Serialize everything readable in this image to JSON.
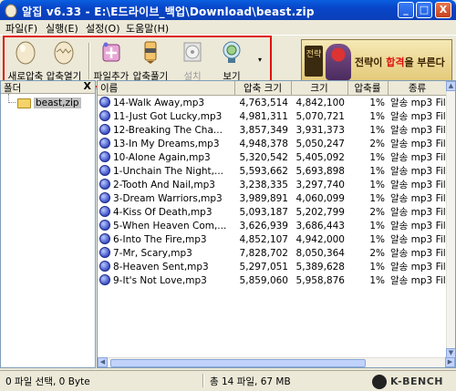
{
  "window": {
    "title": "알집  v6.33 - E:\\E드라이브_백업\\Download\\beast.zip",
    "min_label": "_",
    "max_label": "□",
    "close_label": "X"
  },
  "menu": [
    {
      "label": "파일(F)"
    },
    {
      "label": "실행(E)"
    },
    {
      "label": "설정(O)"
    },
    {
      "label": "도움말(H)"
    }
  ],
  "toolbar": {
    "buttons": [
      {
        "label": "새로압축",
        "icon": "new-archive-egg-icon",
        "enabled": true
      },
      {
        "label": "압축열기",
        "icon": "open-archive-egg-icon",
        "enabled": true
      },
      {
        "label": "파일추가",
        "icon": "add-file-icon",
        "enabled": true
      },
      {
        "label": "압축풀기",
        "icon": "extract-icon",
        "enabled": true
      },
      {
        "label": "설치",
        "icon": "install-cd-icon",
        "enabled": false
      },
      {
        "label": "보기",
        "icon": "view-icon",
        "enabled": true
      }
    ],
    "more_arrow": "▾"
  },
  "banner": {
    "seal_text": "전략",
    "text_before": "전략이 ",
    "text_highlight": "합격",
    "text_after": "을 부른다"
  },
  "folder_pane": {
    "header": "폴더",
    "close": "X",
    "tree": [
      {
        "label": "beast,zip"
      }
    ]
  },
  "file_list": {
    "columns": [
      "이름",
      "압축 크기",
      "크기",
      "압축률",
      "종류"
    ],
    "rows": [
      {
        "name": "14-Walk Away,mp3",
        "packed": "4,763,514",
        "size": "4,842,100",
        "ratio": "1%",
        "type": "알송 mp3 File"
      },
      {
        "name": "11-Just Got Lucky,mp3",
        "packed": "4,981,311",
        "size": "5,070,721",
        "ratio": "1%",
        "type": "알송 mp3 File"
      },
      {
        "name": "12-Breaking The Cha...",
        "packed": "3,857,349",
        "size": "3,931,373",
        "ratio": "1%",
        "type": "알송 mp3 File"
      },
      {
        "name": "13-In My Dreams,mp3",
        "packed": "4,948,378",
        "size": "5,050,247",
        "ratio": "2%",
        "type": "알송 mp3 File"
      },
      {
        "name": "10-Alone Again,mp3",
        "packed": "5,320,542",
        "size": "5,405,092",
        "ratio": "1%",
        "type": "알송 mp3 File"
      },
      {
        "name": "1-Unchain The Night,...",
        "packed": "5,593,662",
        "size": "5,693,898",
        "ratio": "1%",
        "type": "알송 mp3 File"
      },
      {
        "name": "2-Tooth And Nail,mp3",
        "packed": "3,238,335",
        "size": "3,297,740",
        "ratio": "1%",
        "type": "알송 mp3 File"
      },
      {
        "name": "3-Dream Warriors,mp3",
        "packed": "3,989,891",
        "size": "4,060,099",
        "ratio": "1%",
        "type": "알송 mp3 File"
      },
      {
        "name": "4-Kiss Of Death,mp3",
        "packed": "5,093,187",
        "size": "5,202,799",
        "ratio": "2%",
        "type": "알송 mp3 File"
      },
      {
        "name": "5-When Heaven Com,...",
        "packed": "3,626,939",
        "size": "3,686,443",
        "ratio": "1%",
        "type": "알송 mp3 File"
      },
      {
        "name": "6-Into The Fire,mp3",
        "packed": "4,852,107",
        "size": "4,942,000",
        "ratio": "1%",
        "type": "알송 mp3 File"
      },
      {
        "name": "7-Mr, Scary,mp3",
        "packed": "7,828,702",
        "size": "8,050,364",
        "ratio": "2%",
        "type": "알송 mp3 File"
      },
      {
        "name": "8-Heaven Sent,mp3",
        "packed": "5,297,051",
        "size": "5,389,628",
        "ratio": "1%",
        "type": "알송 mp3 File"
      },
      {
        "name": "9-It's Not Love,mp3",
        "packed": "5,859,060",
        "size": "5,958,876",
        "ratio": "1%",
        "type": "알송 mp3 File"
      }
    ]
  },
  "status": {
    "selection": "0 파일 선택,  0 Byte",
    "total": "총 14 파일,   67 MB",
    "logo": "K-BENCH"
  },
  "colors": {
    "titlebar": "#0845c8",
    "highlight_box": "#e01010",
    "window_bg": "#ece9d8"
  }
}
